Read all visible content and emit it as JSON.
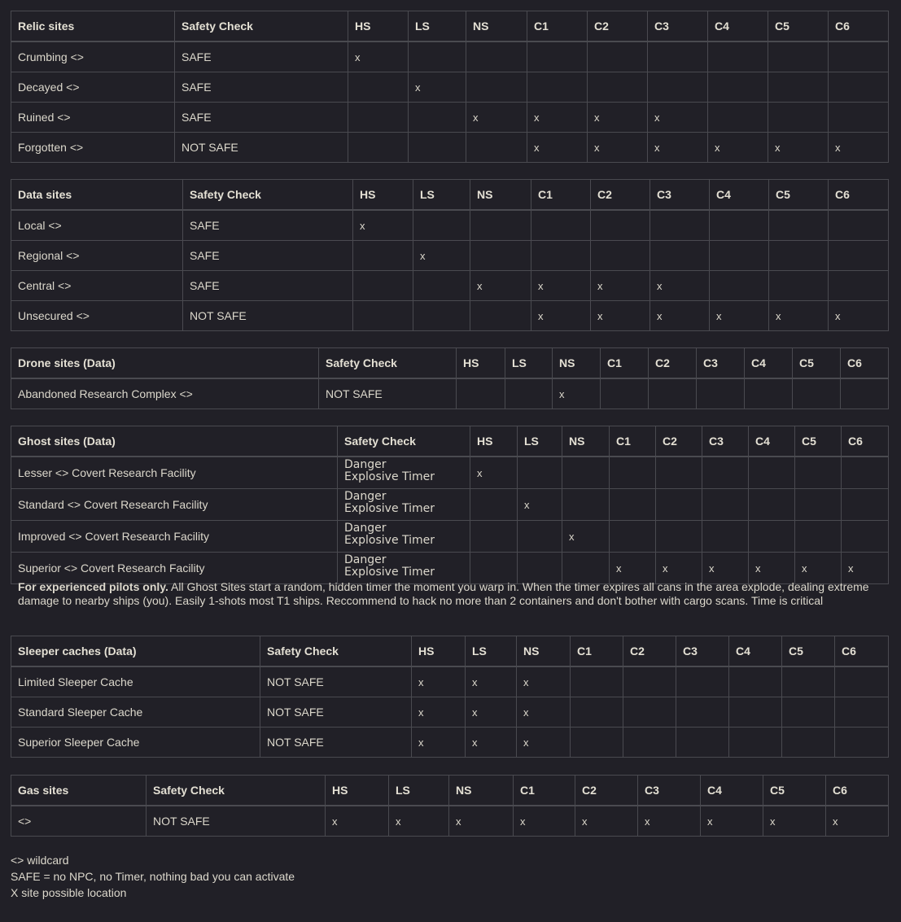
{
  "columns": [
    "HS",
    "LS",
    "NS",
    "C1",
    "C2",
    "C3",
    "C4",
    "C5",
    "C6"
  ],
  "safety_header": "Safety Check",
  "mark": "x",
  "tables": {
    "relic": {
      "title": "Relic sites",
      "rows": [
        {
          "name": "Crumbing <>",
          "safety": "SAFE",
          "marks": [
            1,
            0,
            0,
            0,
            0,
            0,
            0,
            0,
            0
          ]
        },
        {
          "name": "Decayed <>",
          "safety": "SAFE",
          "marks": [
            0,
            1,
            0,
            0,
            0,
            0,
            0,
            0,
            0
          ]
        },
        {
          "name": "Ruined <>",
          "safety": "SAFE",
          "marks": [
            0,
            0,
            1,
            1,
            1,
            1,
            0,
            0,
            0
          ]
        },
        {
          "name": "Forgotten <>",
          "safety": "NOT SAFE",
          "marks": [
            0,
            0,
            0,
            1,
            1,
            1,
            1,
            1,
            1
          ]
        }
      ]
    },
    "data": {
      "title": "Data sites",
      "rows": [
        {
          "name": "Local <>",
          "safety": "SAFE",
          "marks": [
            1,
            0,
            0,
            0,
            0,
            0,
            0,
            0,
            0
          ]
        },
        {
          "name": "Regional <>",
          "safety": "SAFE",
          "marks": [
            0,
            1,
            0,
            0,
            0,
            0,
            0,
            0,
            0
          ]
        },
        {
          "name": "Central <>",
          "safety": "SAFE",
          "marks": [
            0,
            0,
            1,
            1,
            1,
            1,
            0,
            0,
            0
          ]
        },
        {
          "name": "Unsecured <>",
          "safety": "NOT SAFE",
          "marks": [
            0,
            0,
            0,
            1,
            1,
            1,
            1,
            1,
            1
          ]
        }
      ]
    },
    "drone": {
      "title": "Drone sites (Data)",
      "rows": [
        {
          "name": "Abandoned Research Complex <>",
          "safety": "NOT SAFE",
          "marks": [
            0,
            0,
            1,
            0,
            0,
            0,
            0,
            0,
            0
          ]
        }
      ]
    },
    "ghost": {
      "title": "Ghost sites (Data)",
      "rows": [
        {
          "name": "Lesser <> Covert Research Facility",
          "safety": "Danger",
          "safety2": "Explosive Timer",
          "marks": [
            1,
            0,
            0,
            0,
            0,
            0,
            0,
            0,
            0
          ]
        },
        {
          "name": "Standard <> Covert Research Facility",
          "safety": "Danger",
          "safety2": "Explosive Timer",
          "marks": [
            0,
            1,
            0,
            0,
            0,
            0,
            0,
            0,
            0
          ]
        },
        {
          "name": "Improved <> Covert Research Facility",
          "safety": "Danger",
          "safety2": "Explosive Timer",
          "marks": [
            0,
            0,
            1,
            0,
            0,
            0,
            0,
            0,
            0
          ]
        },
        {
          "name": "Superior <> Covert Research Facility",
          "safety": "Danger",
          "safety2": "Explosive Timer",
          "marks": [
            0,
            0,
            0,
            1,
            1,
            1,
            1,
            1,
            1
          ]
        }
      ]
    },
    "sleeper": {
      "title": "Sleeper caches (Data)",
      "rows": [
        {
          "name": "Limited Sleeper Cache",
          "safety": "NOT SAFE",
          "marks": [
            1,
            1,
            1,
            0,
            0,
            0,
            0,
            0,
            0
          ]
        },
        {
          "name": "Standard Sleeper Cache",
          "safety": "NOT SAFE",
          "marks": [
            1,
            1,
            1,
            0,
            0,
            0,
            0,
            0,
            0
          ]
        },
        {
          "name": "Superior Sleeper Cache",
          "safety": "NOT SAFE",
          "marks": [
            1,
            1,
            1,
            0,
            0,
            0,
            0,
            0,
            0
          ]
        }
      ]
    },
    "gas": {
      "title": "Gas sites",
      "rows": [
        {
          "name": "<>",
          "safety": "NOT SAFE",
          "marks": [
            1,
            1,
            1,
            1,
            1,
            1,
            1,
            1,
            1
          ]
        }
      ]
    }
  },
  "ghost_note": {
    "bold": "For experienced pilots only.",
    "text": " All Ghost Sites start a random, hidden timer the moment you warp in. When the timer expires all cans in the area explode, dealing extreme damage to nearby ships (you). Easily 1-shots most T1 ships. Reccommend to hack no more than 2 containers and don't bother with cargo scans. Time is critical"
  },
  "legend": [
    "<> wildcard",
    "SAFE = no NPC, no Timer, nothing bad you can activate",
    "X site possible location"
  ]
}
